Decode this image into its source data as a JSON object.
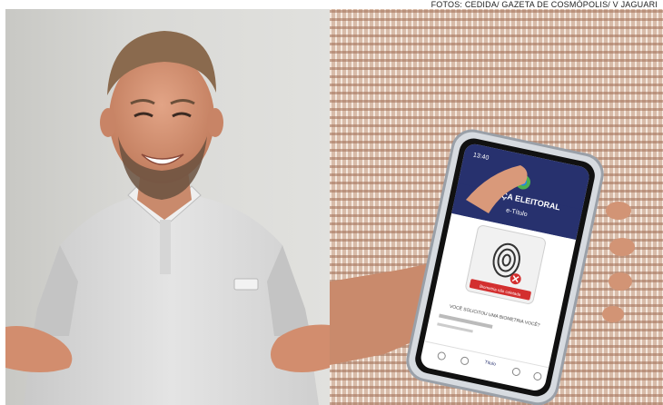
{
  "credit": "FOTOS: CEDIDA/ GAZETA DE COSMÓPOLIS/ V JAGUARI",
  "phone": {
    "status_time": "13:40",
    "app_title": "JUSTIÇA ELEITORAL",
    "app_subtitle": "e-Título",
    "biometry_status": "Biometria não coletada",
    "question": "VOCÊ SOLICITOU UMA BIOMETRIA VOCÊ?",
    "nav_label": "Título"
  },
  "colors": {
    "app_header": "#27316e",
    "alert_red": "#d32f2f",
    "shirt": "#dcdcdc"
  }
}
